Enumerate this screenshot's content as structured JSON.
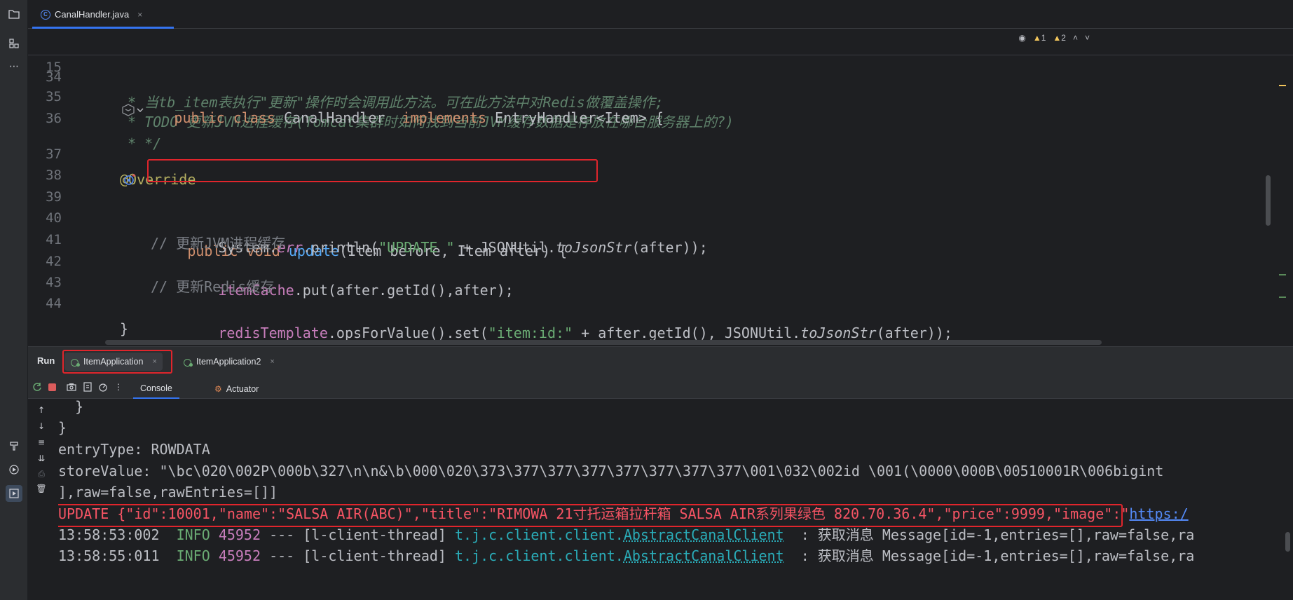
{
  "editor": {
    "tab": {
      "filename": "CanalHandler.java",
      "close": "×",
      "icon_letter": "C"
    },
    "inspections": {
      "warnings": "1",
      "weak": "2"
    },
    "sticky": {
      "line_number": "15",
      "tokens": {
        "kw1": "public",
        "kw2": "class",
        "name": "CanalHandler",
        "kw3": "implements",
        "rest": "EntryHandler<Item> {"
      }
    },
    "lines": [
      {
        "n": "34",
        "text": "* 当tb_item表执行\"更新\"操作时会调用此方法。可在此方法中对Redis做覆盖操作;"
      },
      {
        "n": "35",
        "text": "* TODO 更新JVM进程缓存(Tomcat集群时如何找到当前JVM缓存数据是存放在哪台服务器上的?)"
      },
      {
        "n": "36",
        "text": "* */"
      },
      {
        "n": "37",
        "text": "@Override"
      },
      {
        "n": "38",
        "kw": "public void",
        "fn": "update",
        "rest": "(Item before, Item after) {"
      },
      {
        "n": "39",
        "a": "System.",
        "b": "err",
        "c": ".println(",
        "d": "\"UPDATE \"",
        "e": " + JSONUtil.",
        "f": "toJsonStr",
        "g": "(after));"
      },
      {
        "n": "40",
        "text": "// 更新JVM进程缓存"
      },
      {
        "n": "41",
        "a": "itemCache",
        "b": ".put(after.getId(),after);"
      },
      {
        "n": "42",
        "text": "// 更新Redis缓存"
      },
      {
        "n": "43",
        "a": "redisTemplate",
        "b": ".opsForValue().set(",
        "c": "\"item:id:\"",
        "d": " + after.getId(), JSONUtil.",
        "e": "toJsonStr",
        "f": "(after));"
      },
      {
        "n": "44",
        "text": "}"
      }
    ]
  },
  "run": {
    "label": "Run",
    "tabs": [
      {
        "label": "ItemApplication",
        "close": "×"
      },
      {
        "label": "ItemApplication2",
        "close": "×"
      }
    ],
    "subtabs": {
      "console": "Console",
      "actuator": "Actuator"
    },
    "console": {
      "l1": "  }",
      "l2": "}",
      "l3": "entryType: ROWDATA",
      "l4": "storeValue: \"\\bc\\020\\002P\\000b\\327\\n\\n&\\b\\000\\020\\373\\377\\377\\377\\377\\377\\377\\377\\001\\032\\002id \\001(\\0000\\000B\\00510001R\\006bigint",
      "l5": "],raw=false,rawEntries=[]]",
      "l6_text": "UPDATE {\"id\":10001,\"name\":\"SALSA AIR(ABC)\",\"title\":\"RIMOWA 21寸托运箱拉杆箱 SALSA AIR系列果绿色 820.70.36.4\",\"price\":9999,\"image\":\"",
      "l6_link": "https:/",
      "logs": [
        {
          "time": "13:58:53:002",
          "level": "INFO",
          "pid": "45952",
          "sep": "---",
          "thread": "[l-client-thread]",
          "pkg": "t.j.c.client.client.",
          "cls": "AbstractCanalClient",
          "msg": "  : 获取消息 Message[id=-1,entries=[],raw=false,ra"
        },
        {
          "time": "13:58:55:011",
          "level": "INFO",
          "pid": "45952",
          "sep": "---",
          "thread": "[l-client-thread]",
          "pkg": "t.j.c.client.client.",
          "cls": "AbstractCanalClient",
          "msg": "  : 获取消息 Message[id=-1,entries=[],raw=false,ra"
        }
      ]
    }
  },
  "colors": {
    "accent": "#3574f0",
    "error_box": "#e0252c",
    "keyword": "#cf8e6d",
    "string": "#6aab73",
    "function": "#56a8f5",
    "field": "#c77dbb"
  },
  "icons": [
    "folder-icon",
    "structure-icon",
    "more-icon",
    "build-icon",
    "services-icon",
    "run-icon",
    "rerun-icon",
    "stop-icon",
    "screenshot-icon",
    "dump-icon",
    "profile-icon",
    "more-options-icon",
    "arrow-up-icon",
    "arrow-down-icon",
    "soft-wrap-icon",
    "scroll-end-icon",
    "print-icon",
    "trash-icon",
    "actuator-icon",
    "class-icon",
    "spring-app-icon",
    "ai-icon",
    "chevron-down-icon",
    "implementation-icon"
  ]
}
